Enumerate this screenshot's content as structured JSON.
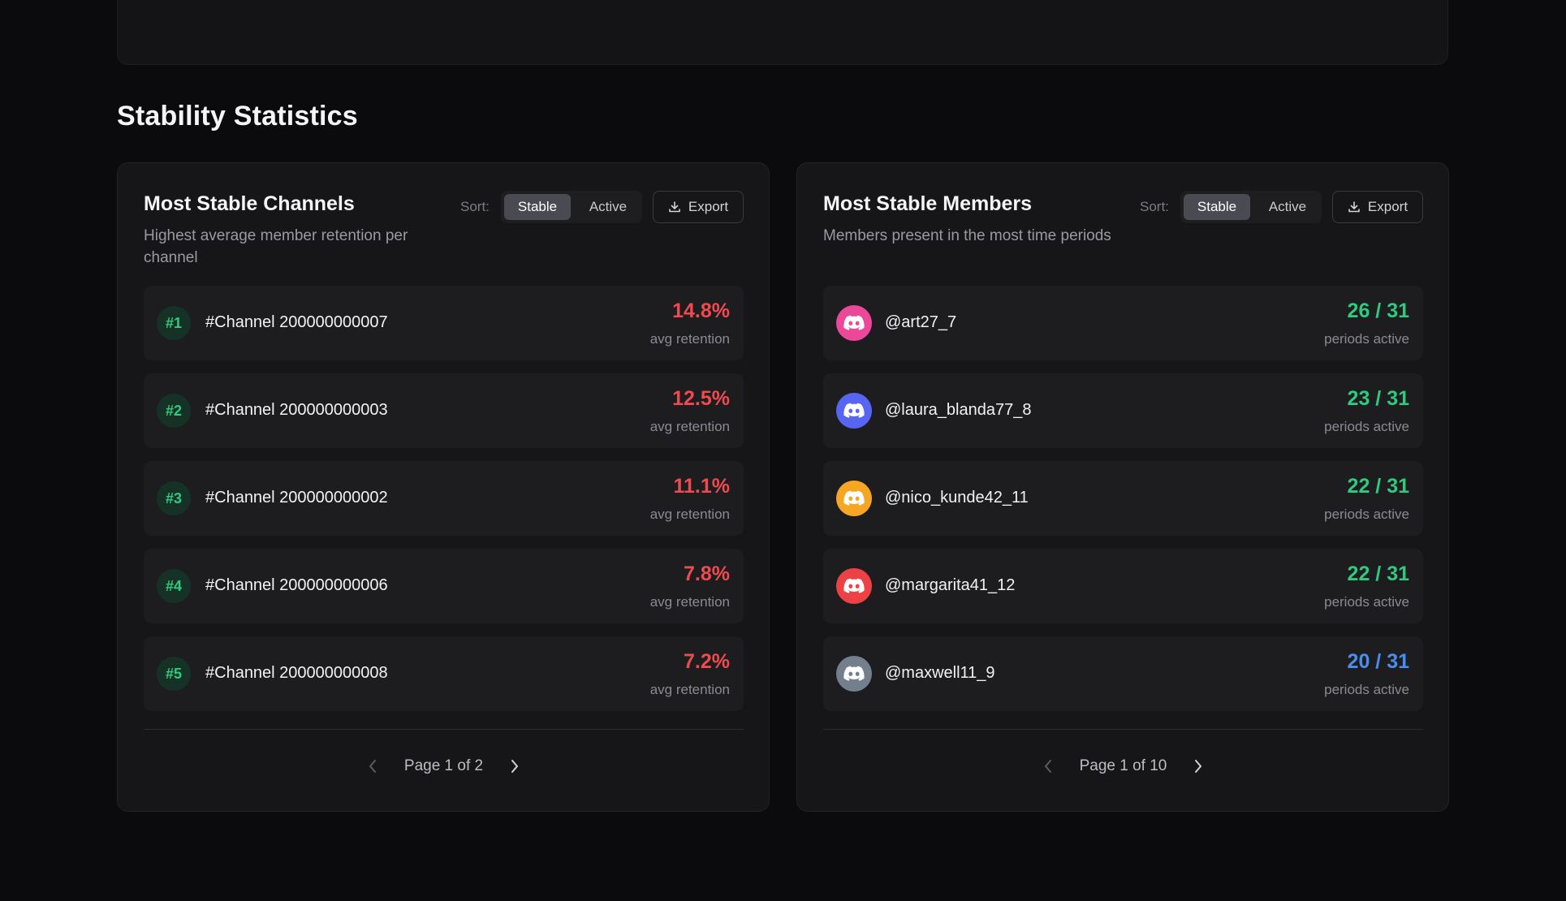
{
  "section": {
    "title": "Stability Statistics"
  },
  "channels": {
    "title": "Most Stable Channels",
    "subtitle": "Highest average member retention per channel",
    "sort_label": "Sort:",
    "sort_options": [
      "Stable",
      "Active"
    ],
    "selected_sort": "Stable",
    "export_label": "Export",
    "rows": [
      {
        "rank": "#1",
        "name": "#Channel 200000000007",
        "value": "14.8%",
        "caption": "avg retention"
      },
      {
        "rank": "#2",
        "name": "#Channel 200000000003",
        "value": "12.5%",
        "caption": "avg retention"
      },
      {
        "rank": "#3",
        "name": "#Channel 200000000002",
        "value": "11.1%",
        "caption": "avg retention"
      },
      {
        "rank": "#4",
        "name": "#Channel 200000000006",
        "value": "7.8%",
        "caption": "avg retention"
      },
      {
        "rank": "#5",
        "name": "#Channel 200000000008",
        "value": "7.2%",
        "caption": "avg retention"
      }
    ],
    "value_color": "#ef4a4f",
    "pager": "Page 1 of 2"
  },
  "members": {
    "title": "Most Stable Members",
    "subtitle": "Members present in the most time periods",
    "sort_label": "Sort:",
    "sort_options": [
      "Stable",
      "Active"
    ],
    "selected_sort": "Stable",
    "export_label": "Export",
    "rows": [
      {
        "name": "@art27_7",
        "value": "26 / 31",
        "caption": "periods active",
        "avatar_color": "#ec4899",
        "value_color": "#2fca7e"
      },
      {
        "name": "@laura_blanda77_8",
        "value": "23 / 31",
        "caption": "periods active",
        "avatar_color": "#5865f2",
        "value_color": "#2fca7e"
      },
      {
        "name": "@nico_kunde42_11",
        "value": "22 / 31",
        "caption": "periods active",
        "avatar_color": "#f5a623",
        "value_color": "#2fca7e"
      },
      {
        "name": "@margarita41_12",
        "value": "22 / 31",
        "caption": "periods active",
        "avatar_color": "#ed4245",
        "value_color": "#2fca7e"
      },
      {
        "name": "@maxwell11_9",
        "value": "20 / 31",
        "caption": "periods active",
        "avatar_color": "#747f8d",
        "value_color": "#4a8df0"
      }
    ],
    "avatar_icon": "discord-icon",
    "pager": "Page 1 of 10"
  },
  "icons": {
    "export": "download-icon",
    "prev": "chevron-left-icon",
    "next": "chevron-right-icon"
  }
}
